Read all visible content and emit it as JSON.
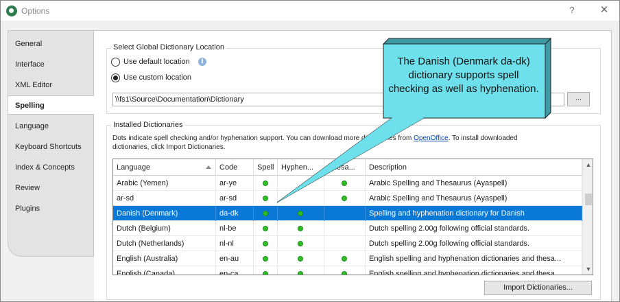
{
  "window": {
    "title": "Options",
    "help_glyph": "?",
    "close_glyph": "✕"
  },
  "sidebar": {
    "items": [
      {
        "label": "General"
      },
      {
        "label": "Interface"
      },
      {
        "label": "XML Editor"
      },
      {
        "label": "Spelling",
        "active": true
      },
      {
        "label": "Language"
      },
      {
        "label": "Keyboard Shortcuts"
      },
      {
        "label": "Index & Concepts"
      },
      {
        "label": "Review"
      },
      {
        "label": "Plugins"
      }
    ]
  },
  "location": {
    "group_label": "Select Global Dictionary Location",
    "default_label": "Use default location",
    "custom_label": "Use custom location",
    "selected": "custom",
    "path_value": "\\\\fs1\\Source\\Documentation\\Dictionary",
    "browse_label": "..."
  },
  "installed": {
    "group_label": "Installed Dictionaries",
    "desc_part1": "Dots indicate spell checking and/or hyphenation support. You can download more dictionaries from ",
    "desc_link": "OpenOffice",
    "desc_part2": ". To install downloaded",
    "desc_line2": "dictionaries, click Import Dictionaries.",
    "columns": {
      "language": "Language",
      "code": "Code",
      "spell": "Spell",
      "hyphen": "Hyphen...",
      "thesaurus": "Thesa...",
      "description": "Description"
    },
    "rows": [
      {
        "language": "Arabic (Yemen)",
        "code": "ar-ye",
        "spell": true,
        "hyphen": false,
        "thesaurus": true,
        "description": "Arabic Spelling and Thesaurus (Ayaspell)"
      },
      {
        "language": "ar-sd",
        "code": "ar-sd",
        "spell": true,
        "hyphen": false,
        "thesaurus": true,
        "description": "Arabic Spelling and Thesaurus (Ayaspell)"
      },
      {
        "language": "Danish (Denmark)",
        "code": "da-dk",
        "spell": true,
        "hyphen": true,
        "thesaurus": false,
        "description": "Spelling and hyphenation dictionary for Danish",
        "selected": true
      },
      {
        "language": "Dutch (Belgium)",
        "code": "nl-be",
        "spell": true,
        "hyphen": true,
        "thesaurus": false,
        "description": "Dutch spelling 2.00g following official standards."
      },
      {
        "language": "Dutch (Netherlands)",
        "code": "nl-nl",
        "spell": true,
        "hyphen": true,
        "thesaurus": false,
        "description": "Dutch spelling 2.00g following official standards."
      },
      {
        "language": "English (Australia)",
        "code": "en-au",
        "spell": true,
        "hyphen": true,
        "thesaurus": true,
        "description": "English spelling and hyphenation dictionaries and thesa..."
      },
      {
        "language": "English (Canada)",
        "code": "en-ca",
        "spell": true,
        "hyphen": true,
        "thesaurus": true,
        "description": "English spelling and hyphenation dictionaries and thesa..."
      }
    ],
    "import_label": "Import Dictionaries..."
  },
  "callout": {
    "text": "The Danish (Denmark da-dk) dictionary supports spell checking as well as hyphenation."
  },
  "colors": {
    "selection": "#0a78d7",
    "dot": "#2fbd25",
    "callout_fill": "#6ee0eb",
    "link": "#0645ad"
  },
  "icons": {
    "app": "app-logo-icon",
    "info": "info-icon",
    "sort": "sort-ascending-icon",
    "scroll_up": "chevron-up-icon",
    "scroll_down": "chevron-down-icon"
  }
}
